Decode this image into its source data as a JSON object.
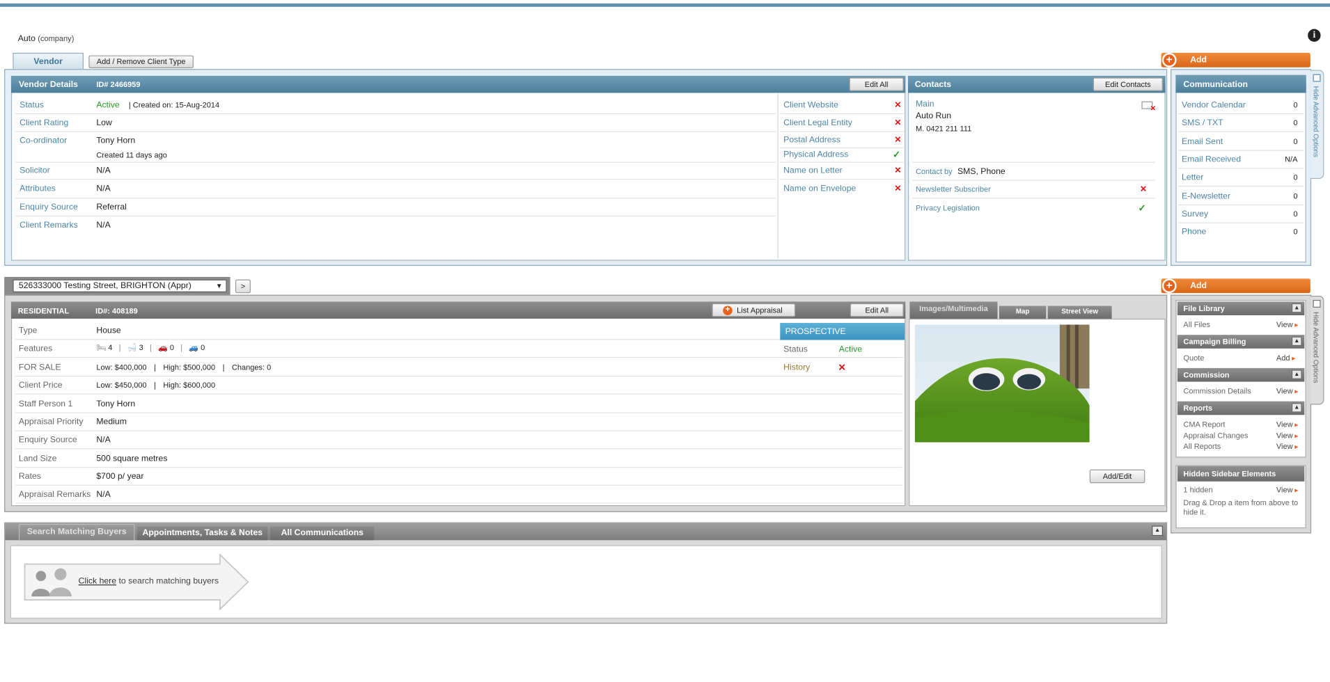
{
  "header": {
    "company_name": "Auto",
    "company_suffix": "(company)",
    "info_icon": "info-icon"
  },
  "client_tabs": {
    "active_tab": "Vendor",
    "add_remove_button": "Add / Remove Client Type"
  },
  "add_label": "Add",
  "hide_advanced_label": "Hide Advanced Options",
  "vendor_details": {
    "title": "Vendor Details",
    "id_label": "ID# 2466959",
    "edit_all": "Edit All",
    "rows": [
      {
        "label": "Status",
        "value": "Active",
        "extra": "|   Created on: 15-Aug-2014"
      },
      {
        "label": "Client Rating",
        "value": "Low"
      },
      {
        "label": "Co-ordinator",
        "value": "Tony Horn",
        "sub": "Created 11 days ago"
      },
      {
        "label": "Solicitor",
        "value": "N/A"
      },
      {
        "label": "Attributes",
        "value": "N/A"
      },
      {
        "label": "Enquiry Source",
        "value": "Referral"
      },
      {
        "label": "Client Remarks",
        "value": "N/A"
      }
    ],
    "checks": [
      {
        "label": "Client Website",
        "state": "x"
      },
      {
        "label": "Client Legal Entity",
        "state": "x"
      },
      {
        "label": "Postal Address",
        "state": "x"
      },
      {
        "label": "Physical Address",
        "state": "check"
      },
      {
        "label": "Name on Letter",
        "state": "x"
      },
      {
        "label": "Name on Envelope",
        "state": "x"
      }
    ]
  },
  "contacts": {
    "title": "Contacts",
    "edit_button": "Edit Contacts",
    "main_label": "Main",
    "name": "Auto Run",
    "mobile": "M. 0421 211 111",
    "contact_by_label": "Contact by",
    "contact_by_value": "SMS, Phone",
    "newsletter": "Newsletter Subscriber",
    "privacy": "Privacy Legislation"
  },
  "communication": {
    "title": "Communication",
    "items": [
      {
        "label": "Vendor Calendar",
        "value": "0"
      },
      {
        "label": "SMS / TXT",
        "value": "0"
      },
      {
        "label": "Email Sent",
        "value": "0"
      },
      {
        "label": "Email Received",
        "value": "N/A"
      },
      {
        "label": "Letter",
        "value": "0"
      },
      {
        "label": "E-Newsletter",
        "value": "0"
      },
      {
        "label": "Survey",
        "value": "0"
      },
      {
        "label": "Phone",
        "value": "0"
      }
    ]
  },
  "property_select": {
    "value": "526333000 Testing Street, BRIGHTON (Appr)",
    "go": ">"
  },
  "property": {
    "title": "RESIDENTIAL",
    "id_label": "ID#: 408189",
    "list_appraisal": "List Appraisal",
    "edit_all": "Edit All",
    "type_label": "Type",
    "type_value": "House",
    "features_label": "Features",
    "bedrooms": "4",
    "bathrooms": "3",
    "garages": "0",
    "carports": "0",
    "forsale_label": "FOR SALE",
    "forsale_low": "Low:  $400,000",
    "forsale_high": "High:  $500,000",
    "forsale_changes": "Changes: 0",
    "client_price_label": "Client Price",
    "client_low": "Low: $450,000",
    "client_high": "High: $600,000",
    "staff_label": "Staff Person 1",
    "staff_value": "Tony Horn",
    "priority_label": "Appraisal Priority",
    "priority_value": "Medium",
    "enquiry_label": "Enquiry Source",
    "enquiry_value": "N/A",
    "land_label": "Land Size",
    "land_value": "500 square metres",
    "rates_label": "Rates",
    "rates_value": "$700 p/ year",
    "remarks_label": "Appraisal Remarks",
    "remarks_value": "N/A",
    "prospective_header": "PROSPECTIVE",
    "status_label": "Status",
    "status_value": "Active",
    "history_label": "History"
  },
  "media": {
    "tabs": [
      "Images/Multimedia",
      "Map",
      "Street View"
    ],
    "add_edit": "Add/Edit"
  },
  "sidebar": {
    "sections": [
      {
        "title": "File Library",
        "items": [
          {
            "label": "All Files",
            "action": "View"
          }
        ]
      },
      {
        "title": "Campaign Billing",
        "items": [
          {
            "label": "Quote",
            "action": "Add"
          }
        ]
      },
      {
        "title": "Commission",
        "items": [
          {
            "label": "Commission Details",
            "action": "View"
          }
        ]
      },
      {
        "title": "Reports",
        "items": [
          {
            "label": "CMA Report",
            "action": "View"
          },
          {
            "label": "Appraisal Changes",
            "action": "View"
          },
          {
            "label": "All Reports",
            "action": "View"
          }
        ]
      }
    ],
    "hidden": {
      "title": "Hidden Sidebar Elements",
      "count": "1 hidden",
      "action": "View",
      "hint": "Drag & Drop a item from above to hide it."
    }
  },
  "bottom": {
    "tabs": [
      "Search Matching Buyers",
      "Appointments, Tasks & Notes",
      "All Communications"
    ],
    "link_text": "Click here",
    "link_rest": " to search matching buyers"
  },
  "colors": {
    "accent_blue": "#4d86a8",
    "orange": "#e8601a",
    "status_green": "#2a9a2a",
    "error_red": "#dd1111"
  }
}
